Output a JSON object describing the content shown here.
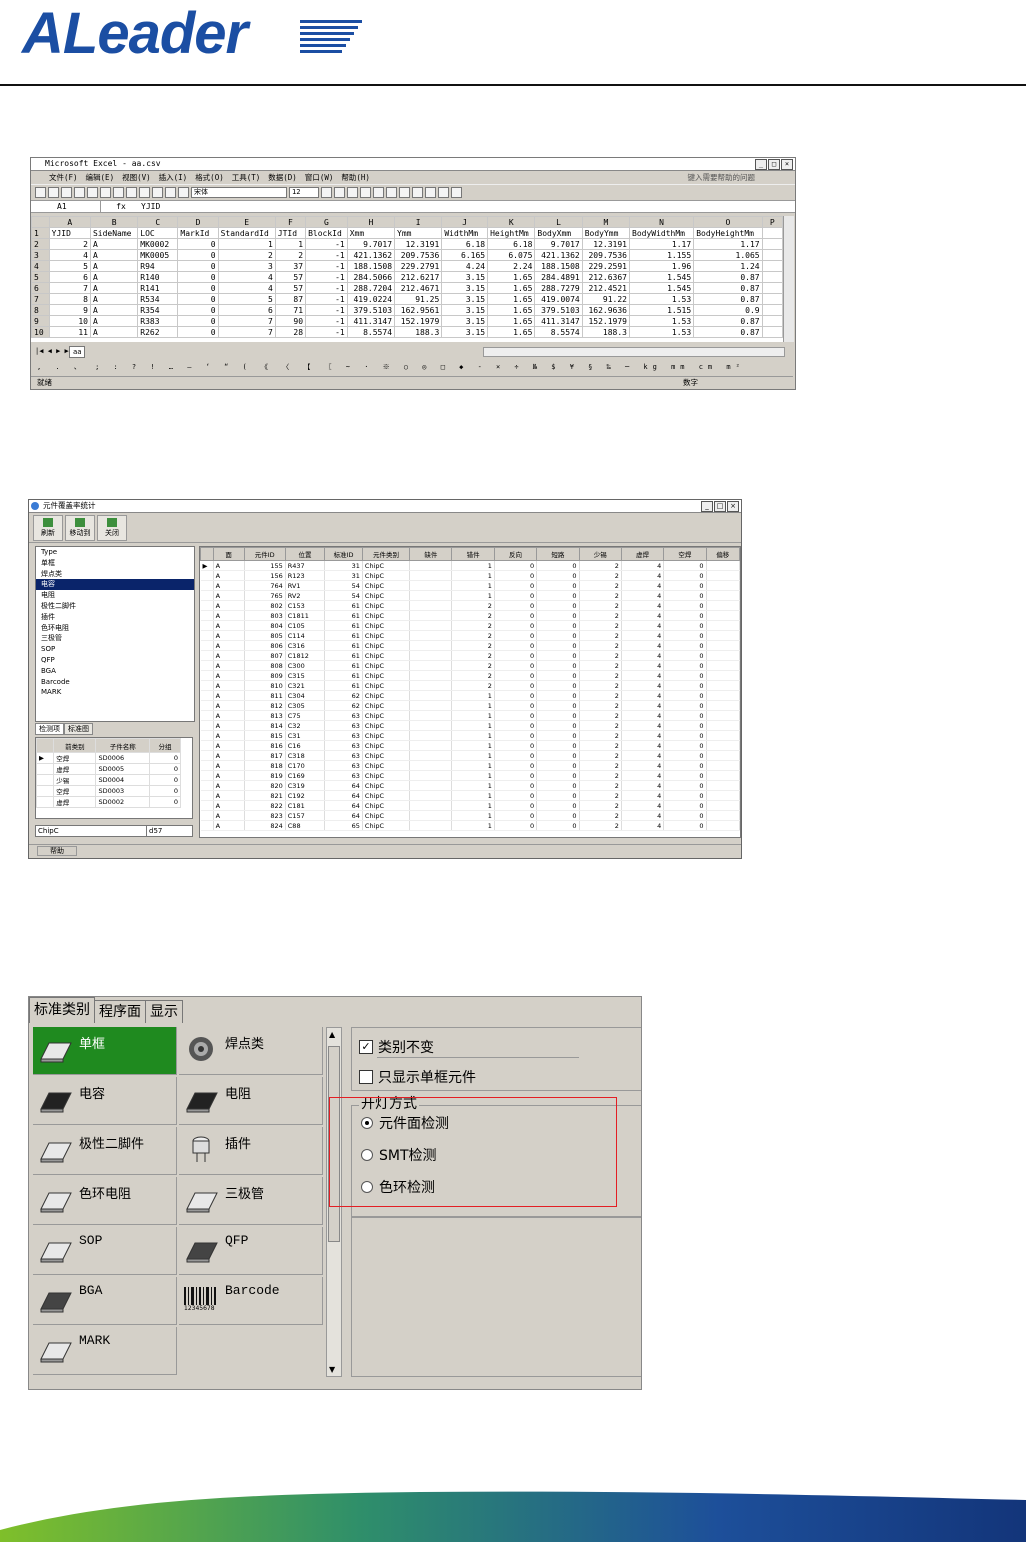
{
  "logo": {
    "text": "ALeader"
  },
  "excel": {
    "title": "Microsoft Excel - aa.csv",
    "menu": [
      "文件(F)",
      "编辑(E)",
      "视图(V)",
      "插入(I)",
      "格式(O)",
      "工具(T)",
      "数据(D)",
      "窗口(W)",
      "帮助(H)"
    ],
    "help_placeholder": "键入需要帮助的问题",
    "font": "宋体",
    "font_size": "12",
    "namebox": "A1",
    "formula": "YJID",
    "columns": [
      "",
      "A",
      "B",
      "C",
      "D",
      "E",
      "F",
      "G",
      "H",
      "I",
      "J",
      "K",
      "L",
      "M",
      "N",
      "O",
      "P"
    ],
    "rows": [
      [
        "1",
        "YJID",
        "SideName",
        "LOC",
        "MarkId",
        "StandardId",
        "JTId",
        "BlockId",
        "Xmm",
        "Ymm",
        "WidthMm",
        "HeightMm",
        "BodyXmm",
        "BodyYmm",
        "BodyWidthMm",
        "BodyHeightMm",
        ""
      ],
      [
        "2",
        "2",
        "A",
        "MK0002",
        "0",
        "1",
        "1",
        "-1",
        "9.7017",
        "12.3191",
        "6.18",
        "6.18",
        "9.7017",
        "12.3191",
        "1.17",
        "1.17",
        ""
      ],
      [
        "3",
        "4",
        "A",
        "MK0005",
        "0",
        "2",
        "2",
        "-1",
        "421.1362",
        "209.7536",
        "6.165",
        "6.075",
        "421.1362",
        "209.7536",
        "1.155",
        "1.065",
        ""
      ],
      [
        "4",
        "5",
        "A",
        "R94",
        "0",
        "3",
        "37",
        "-1",
        "188.1508",
        "229.2791",
        "4.24",
        "2.24",
        "188.1508",
        "229.2591",
        "1.96",
        "1.24",
        ""
      ],
      [
        "5",
        "6",
        "A",
        "R140",
        "0",
        "4",
        "57",
        "-1",
        "284.5066",
        "212.6217",
        "3.15",
        "1.65",
        "284.4891",
        "212.6367",
        "1.545",
        "0.87",
        ""
      ],
      [
        "6",
        "7",
        "A",
        "R141",
        "0",
        "4",
        "57",
        "-1",
        "288.7204",
        "212.4671",
        "3.15",
        "1.65",
        "288.7279",
        "212.4521",
        "1.545",
        "0.87",
        ""
      ],
      [
        "7",
        "8",
        "A",
        "R534",
        "0",
        "5",
        "87",
        "-1",
        "419.0224",
        "91.25",
        "3.15",
        "1.65",
        "419.0074",
        "91.22",
        "1.53",
        "0.87",
        ""
      ],
      [
        "8",
        "9",
        "A",
        "R354",
        "0",
        "6",
        "71",
        "-1",
        "379.5103",
        "162.9561",
        "3.15",
        "1.65",
        "379.5103",
        "162.9636",
        "1.515",
        "0.9",
        ""
      ],
      [
        "9",
        "10",
        "A",
        "R383",
        "0",
        "7",
        "90",
        "-1",
        "411.3147",
        "152.1979",
        "3.15",
        "1.65",
        "411.3147",
        "152.1979",
        "1.53",
        "0.87",
        ""
      ],
      [
        "10",
        "11",
        "A",
        "R262",
        "0",
        "7",
        "28",
        "-1",
        "8.5574",
        "188.3",
        "3.15",
        "1.65",
        "8.5574",
        "188.3",
        "1.53",
        "0.87",
        ""
      ]
    ],
    "sheet_tab": "aa",
    "symbols": ", . 、 ; : ? ! … — ‘ “ ( 《 〈 【 〖 ~ · ※ ○ ◎ □ ◆ - × ÷ № $ ¥ § ‰ ─ kg mm cm m²",
    "status_left": "就绪",
    "status_right": "数字"
  },
  "stats": {
    "title": "元件覆盖率统计",
    "tools": [
      "刷新",
      "移动到",
      "关闭"
    ],
    "types": [
      "Type",
      "单框",
      "焊点类",
      "电容",
      "电阻",
      "极性二脚件",
      "插件",
      "色环电阻",
      "三极管",
      "SOP",
      "QFP",
      "BGA",
      "Barcode",
      "MARK"
    ],
    "selected_type": "电容",
    "lower_tabs": [
      "检测项",
      "标准图"
    ],
    "small_headers": [
      "",
      "前类别",
      "子件名称",
      "分组"
    ],
    "small_rows": [
      [
        "▶",
        "空焊",
        "SD0006",
        "0"
      ],
      [
        "",
        "虚焊",
        "SD0005",
        "0"
      ],
      [
        "",
        "少锡",
        "SD0004",
        "0"
      ],
      [
        "",
        "空焊",
        "SD0003",
        "0"
      ],
      [
        "",
        "虚焊",
        "SD0002",
        "0"
      ]
    ],
    "footer_left": "ChipC",
    "footer_right": "d57",
    "headers": [
      "",
      "面",
      "元件ID",
      "位置",
      "标准ID",
      "元件类别",
      "缺件",
      "错件",
      "反向",
      "短路",
      "少锡",
      "虚焊",
      "空焊",
      "偏移"
    ],
    "rows": [
      [
        "▶",
        "A",
        "155",
        "R437",
        "31",
        "ChipC",
        "",
        "1",
        "0",
        "0",
        "2",
        "4",
        "0",
        ""
      ],
      [
        "",
        "A",
        "156",
        "R123",
        "31",
        "ChipC",
        "",
        "1",
        "0",
        "0",
        "2",
        "4",
        "0",
        ""
      ],
      [
        "",
        "A",
        "764",
        "RV1",
        "54",
        "ChipC",
        "",
        "1",
        "0",
        "0",
        "2",
        "4",
        "0",
        ""
      ],
      [
        "",
        "A",
        "765",
        "RV2",
        "54",
        "ChipC",
        "",
        "1",
        "0",
        "0",
        "2",
        "4",
        "0",
        ""
      ],
      [
        "",
        "A",
        "802",
        "C153",
        "61",
        "ChipC",
        "",
        "2",
        "0",
        "0",
        "2",
        "4",
        "0",
        ""
      ],
      [
        "",
        "A",
        "803",
        "C1811",
        "61",
        "ChipC",
        "",
        "2",
        "0",
        "0",
        "2",
        "4",
        "0",
        ""
      ],
      [
        "",
        "A",
        "804",
        "C105",
        "61",
        "ChipC",
        "",
        "2",
        "0",
        "0",
        "2",
        "4",
        "0",
        ""
      ],
      [
        "",
        "A",
        "805",
        "C114",
        "61",
        "ChipC",
        "",
        "2",
        "0",
        "0",
        "2",
        "4",
        "0",
        ""
      ],
      [
        "",
        "A",
        "806",
        "C316",
        "61",
        "ChipC",
        "",
        "2",
        "0",
        "0",
        "2",
        "4",
        "0",
        ""
      ],
      [
        "",
        "A",
        "807",
        "C1812",
        "61",
        "ChipC",
        "",
        "2",
        "0",
        "0",
        "2",
        "4",
        "0",
        ""
      ],
      [
        "",
        "A",
        "808",
        "C300",
        "61",
        "ChipC",
        "",
        "2",
        "0",
        "0",
        "2",
        "4",
        "0",
        ""
      ],
      [
        "",
        "A",
        "809",
        "C315",
        "61",
        "ChipC",
        "",
        "2",
        "0",
        "0",
        "2",
        "4",
        "0",
        ""
      ],
      [
        "",
        "A",
        "810",
        "C321",
        "61",
        "ChipC",
        "",
        "2",
        "0",
        "0",
        "2",
        "4",
        "0",
        ""
      ],
      [
        "",
        "A",
        "811",
        "C304",
        "62",
        "ChipC",
        "",
        "1",
        "0",
        "0",
        "2",
        "4",
        "0",
        ""
      ],
      [
        "",
        "A",
        "812",
        "C305",
        "62",
        "ChipC",
        "",
        "1",
        "0",
        "0",
        "2",
        "4",
        "0",
        ""
      ],
      [
        "",
        "A",
        "813",
        "C75",
        "63",
        "ChipC",
        "",
        "1",
        "0",
        "0",
        "2",
        "4",
        "0",
        ""
      ],
      [
        "",
        "A",
        "814",
        "C32",
        "63",
        "ChipC",
        "",
        "1",
        "0",
        "0",
        "2",
        "4",
        "0",
        ""
      ],
      [
        "",
        "A",
        "815",
        "C31",
        "63",
        "ChipC",
        "",
        "1",
        "0",
        "0",
        "2",
        "4",
        "0",
        ""
      ],
      [
        "",
        "A",
        "816",
        "C16",
        "63",
        "ChipC",
        "",
        "1",
        "0",
        "0",
        "2",
        "4",
        "0",
        ""
      ],
      [
        "",
        "A",
        "817",
        "C318",
        "63",
        "ChipC",
        "",
        "1",
        "0",
        "0",
        "2",
        "4",
        "0",
        ""
      ],
      [
        "",
        "A",
        "818",
        "C170",
        "63",
        "ChipC",
        "",
        "1",
        "0",
        "0",
        "2",
        "4",
        "0",
        ""
      ],
      [
        "",
        "A",
        "819",
        "C169",
        "63",
        "ChipC",
        "",
        "1",
        "0",
        "0",
        "2",
        "4",
        "0",
        ""
      ],
      [
        "",
        "A",
        "820",
        "C319",
        "64",
        "ChipC",
        "",
        "1",
        "0",
        "0",
        "2",
        "4",
        "0",
        ""
      ],
      [
        "",
        "A",
        "821",
        "C192",
        "64",
        "ChipC",
        "",
        "1",
        "0",
        "0",
        "2",
        "4",
        "0",
        ""
      ],
      [
        "",
        "A",
        "822",
        "C181",
        "64",
        "ChipC",
        "",
        "1",
        "0",
        "0",
        "2",
        "4",
        "0",
        ""
      ],
      [
        "",
        "A",
        "823",
        "C157",
        "64",
        "ChipC",
        "",
        "1",
        "0",
        "0",
        "2",
        "4",
        "0",
        ""
      ],
      [
        "",
        "A",
        "824",
        "C88",
        "65",
        "ChipC",
        "",
        "1",
        "0",
        "0",
        "2",
        "4",
        "0",
        ""
      ]
    ],
    "status": "帮助"
  },
  "standard": {
    "tabs": [
      "标准类别",
      "程序面",
      "显示"
    ],
    "cells": [
      "单框",
      "焊点类",
      "电容",
      "电阻",
      "极性二脚件",
      "插件",
      "色环电阻",
      "三极管",
      "SOP",
      "QFP",
      "BGA",
      "Barcode",
      "MARK"
    ],
    "barcode_digits": "12345678",
    "check1": "类别不变",
    "check2": "只显示单框元件",
    "group_label": "开灯方式",
    "radios": [
      "元件面检测",
      "SMT检测",
      "色环检测"
    ]
  }
}
